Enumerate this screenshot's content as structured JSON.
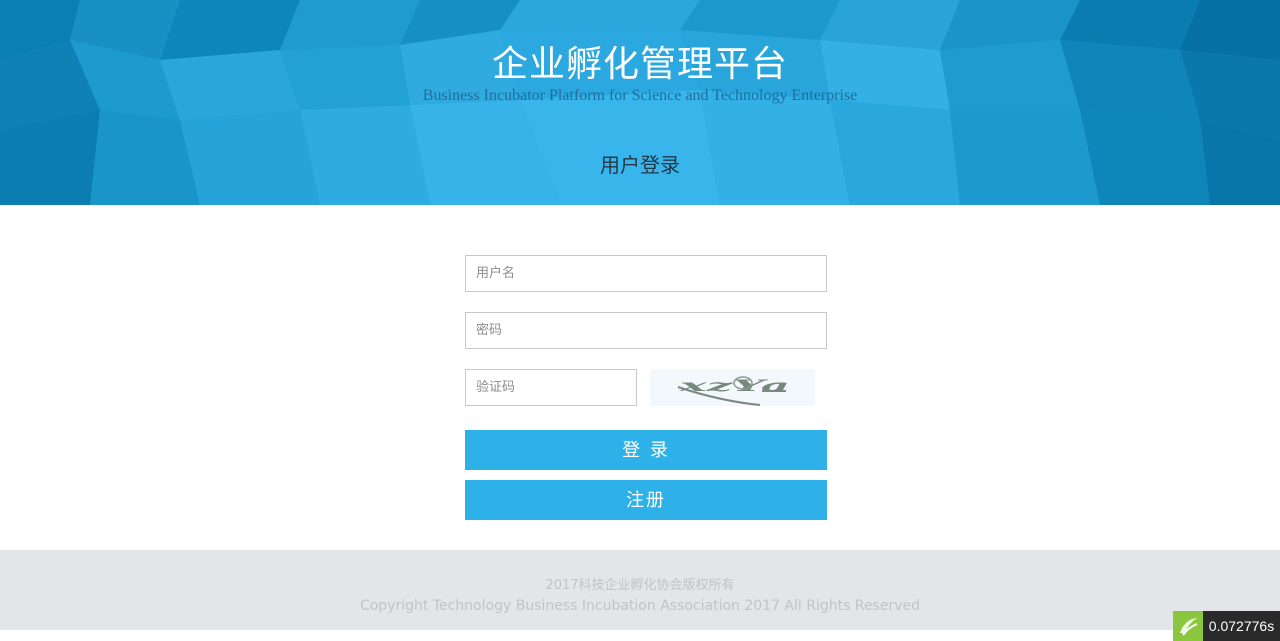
{
  "header": {
    "title": "企业孵化管理平台",
    "subtitle": "Business Incubator Platform for Science and Technology Enterprise",
    "section_title": "用户登录"
  },
  "form": {
    "username_placeholder": "用户名",
    "password_placeholder": "密码",
    "captcha_placeholder": "验证码",
    "captcha_text": "xzYa",
    "login_label": "登 录",
    "register_label": "注册"
  },
  "footer": {
    "line1": "2017科技企业孵化协会版权所有",
    "line2": "Copyright Technology Business Incubation Association 2017 All Rights Reserved"
  },
  "debug": {
    "timer": "0.072776s"
  },
  "colors": {
    "banner": "#1b9bd0",
    "button": "#2eb1e8",
    "footer_bg": "#e4e5e8",
    "footer_text": "#c2c3c6"
  }
}
